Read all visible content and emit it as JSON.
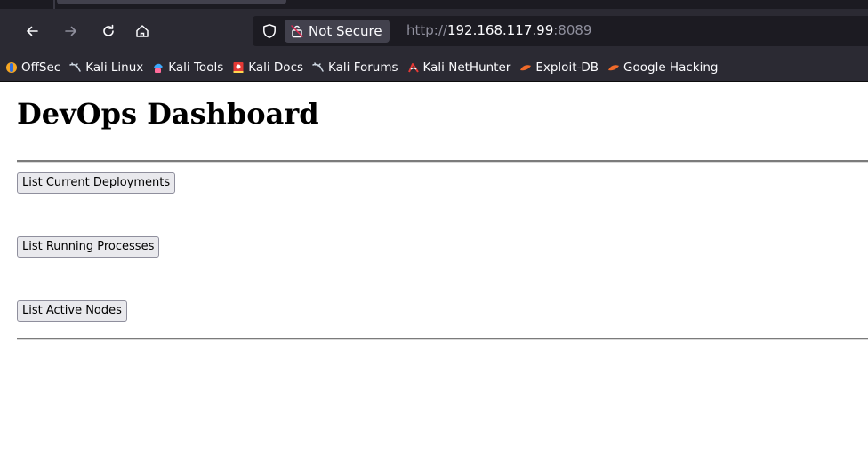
{
  "browser": {
    "nav": {
      "back_icon": "back-arrow-icon",
      "forward_icon": "forward-arrow-icon",
      "reload_icon": "reload-icon",
      "home_icon": "home-icon"
    },
    "urlbar": {
      "security_label": "Not Secure",
      "url_scheme": "http://",
      "url_host": "192.168.117.99",
      "url_port": ":8089"
    },
    "bookmarks": [
      {
        "label": "OffSec",
        "icon": "offsec-icon",
        "color": "#3b82f6"
      },
      {
        "label": "Kali Linux",
        "icon": "kali-dragon-icon",
        "color": "#cfd8e3"
      },
      {
        "label": "Kali Tools",
        "icon": "kali-tools-icon",
        "color": "#3da9fc"
      },
      {
        "label": "Kali Docs",
        "icon": "kali-docs-icon",
        "color": "#e53935"
      },
      {
        "label": "Kali Forums",
        "icon": "kali-dragon-icon",
        "color": "#cfd8e3"
      },
      {
        "label": "Kali NetHunter",
        "icon": "nethunter-icon",
        "color": "#e53935"
      },
      {
        "label": "Exploit-DB",
        "icon": "exploit-db-icon",
        "color": "#f06a2a"
      },
      {
        "label": "Google Hacking",
        "icon": "ghdb-icon",
        "color": "#f06a2a"
      }
    ]
  },
  "page": {
    "title": "DevOps Dashboard",
    "buttons": [
      {
        "label": "List Current Deployments"
      },
      {
        "label": "List Running Processes"
      },
      {
        "label": "List Active Nodes"
      }
    ]
  },
  "colors": {
    "chrome_dark": "#1c1b22",
    "chrome": "#2b2a33",
    "button_bg": "#e9e9ed"
  }
}
